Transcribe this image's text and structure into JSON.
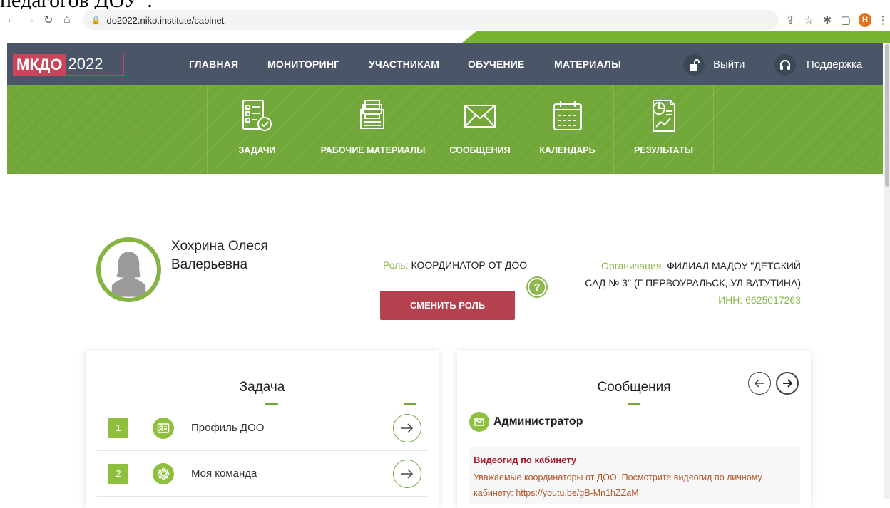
{
  "doc_crop_text": "педагогов ДОУ\".",
  "browser": {
    "url": "do2022.niko.institute/cabinet",
    "profile_initial": "Н"
  },
  "header": {
    "logo_left": "МКДО",
    "logo_right": "2022",
    "menu": [
      "ГЛАВНАЯ",
      "МОНИТОРИНГ",
      "УЧАСТНИКАМ",
      "ОБУЧЕНИЕ",
      "МАТЕРИАЛЫ"
    ],
    "logout": "Выйти",
    "support": "Поддержка"
  },
  "greennav": [
    "ЗАДАЧИ",
    "РАБОЧИЕ МАТЕРИАЛЫ",
    "СООБЩЕНИЯ",
    "КАЛЕНДАРЬ",
    "РЕЗУЛЬТАТЫ"
  ],
  "profile": {
    "name_line1": "Хохрина Олеся",
    "name_line2": "Валерьевна",
    "role_key": "Роль:",
    "role_value": "КООРДИНАТОР ОТ ДОО",
    "help": "?",
    "change_role": "СМЕНИТЬ РОЛЬ",
    "org_key": "Организация:",
    "org_value_1": "ФИЛИАЛ МАДОУ \"ДЕТСКИЙ",
    "org_value_2": "САД № 3\" (Г ПЕРВОУРАЛЬСК, УЛ ВАТУТИНА)",
    "inn": "ИНН: 6625017263"
  },
  "tasks": {
    "title": "Задача",
    "items": [
      {
        "num": "1",
        "label": "Профиль ДОО"
      },
      {
        "num": "2",
        "label": "Моя команда"
      }
    ]
  },
  "messages": {
    "title": "Сообщения",
    "sender": "Администратор",
    "msg_title": "Видеогид по кабинету",
    "msg_text_1": "Уважаемые координаторы от ДОО! Посмотрите видеогид по личному",
    "msg_text_2": "кабинету: https://youtu.be/gB-Mn1hZZaM"
  },
  "colors": {
    "header_bg": "#4a5667",
    "green": "#72a83a",
    "accent_red": "#b5404e"
  }
}
